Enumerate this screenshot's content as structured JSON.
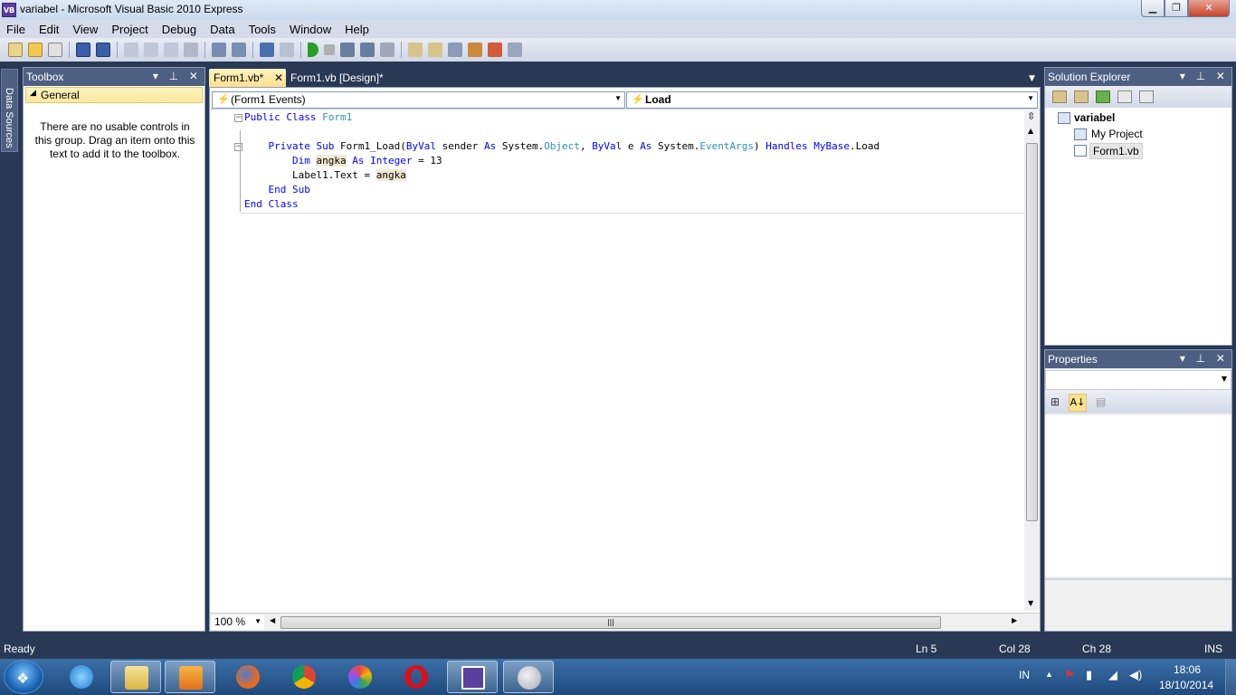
{
  "window": {
    "title": "variabel - Microsoft Visual Basic 2010 Express",
    "app_icon_text": "VB",
    "minimize": "▁",
    "maximize": "❐",
    "close": "✕"
  },
  "menu": [
    "File",
    "Edit",
    "View",
    "Project",
    "Debug",
    "Data",
    "Tools",
    "Window",
    "Help"
  ],
  "toolbar_icons": [
    "new-project-icon",
    "open-icon",
    "add-item-icon",
    "save-icon",
    "save-all-icon",
    "cut-icon",
    "copy-icon",
    "paste-icon",
    "find-icon",
    "comment-icon",
    "uncomment-icon",
    "undo-icon",
    "redo-icon",
    "start-icon",
    "stop-icon",
    "step-into-icon",
    "step-over-icon",
    "step-out-icon",
    "solution-explorer-icon",
    "properties-icon",
    "object-browser-icon",
    "toolbox-icon",
    "extension-icon",
    "more-icon"
  ],
  "left_strip": {
    "tab_label": "Data Sources"
  },
  "toolbox": {
    "title": "Toolbox",
    "group": "General",
    "message": "There are no usable controls in this group. Drag an item onto this text to add it to the toolbox."
  },
  "tabs": [
    {
      "label": "Form1.vb*",
      "active": true
    },
    {
      "label": "Form1.vb [Design]*",
      "active": false
    }
  ],
  "navbar": {
    "left": "(Form1 Events)",
    "right": "Load"
  },
  "code_lines": [
    "Public Class Form1",
    "",
    "Private Sub Form1_Load(ByVal sender As System.Object, ByVal e As System.EventArgs) Handles MyBase.Load",
    "Dim angka As Integer = 13",
    "Label1.Text = angka",
    "End Sub",
    "End Class"
  ],
  "zoom": "100 %",
  "solution_explorer": {
    "title": "Solution Explorer",
    "items": [
      {
        "label": "variabel",
        "bold": true
      },
      {
        "label": "My Project"
      },
      {
        "label": "Form1.vb",
        "selected": true
      }
    ]
  },
  "properties": {
    "title": "Properties"
  },
  "status": {
    "text": "Ready",
    "ln": "Ln 5",
    "col": "Col 28",
    "ch": "Ch 28",
    "mode": "INS"
  },
  "taskbar": {
    "lang": "IN",
    "time": "18:06",
    "date": "18/10/2014",
    "apps": [
      "internet-explorer-icon",
      "file-explorer-icon",
      "media-player-icon",
      "firefox-icon",
      "chrome-icon",
      "picasa-icon",
      "opera-icon",
      "visual-basic-icon",
      "paint-icon"
    ]
  },
  "colors": {
    "chrome_bg": "#293955",
    "pane_header": "#4d6082",
    "active_tab": "#fbe090",
    "keyword": "#0000ff",
    "type": "#2b91af"
  }
}
